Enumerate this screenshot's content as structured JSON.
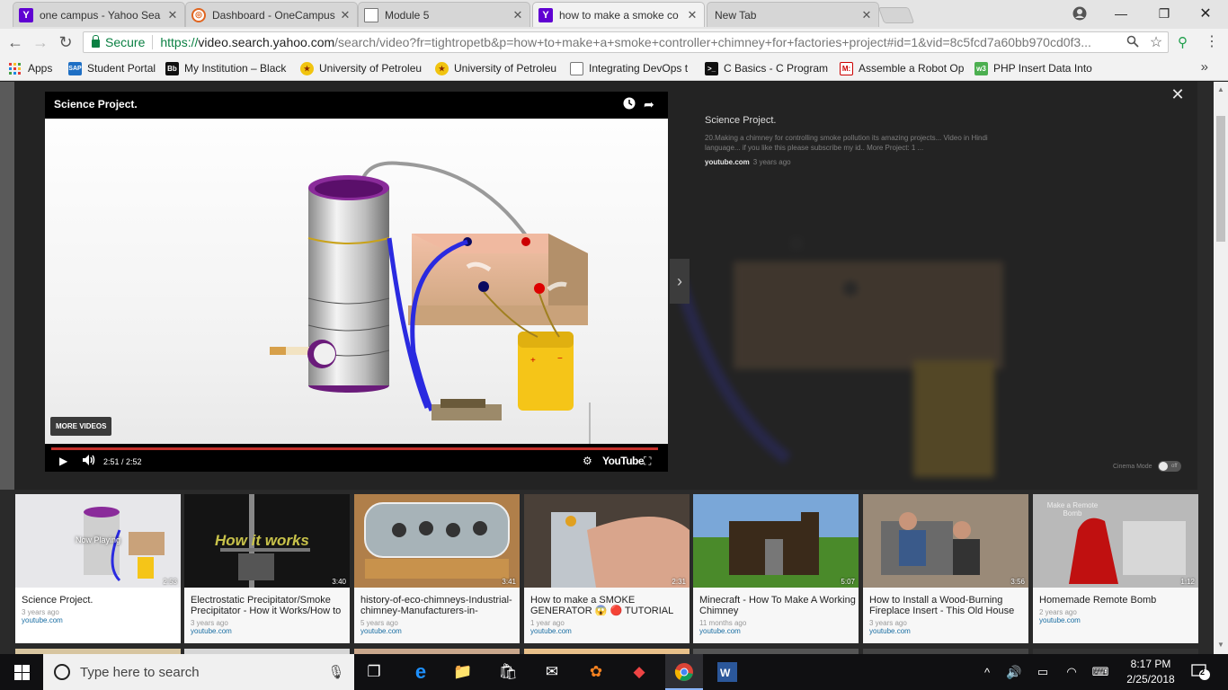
{
  "browser": {
    "tabs": [
      {
        "title": "one campus - Yahoo Sea",
        "favicon": "yahoo-icon",
        "active": false
      },
      {
        "title": "Dashboard - OneCampus",
        "favicon": "globe-icon",
        "active": false
      },
      {
        "title": "Module 5",
        "favicon": "document-icon",
        "active": false
      },
      {
        "title": "how to make a smoke co",
        "favicon": "yahoo-icon",
        "active": true
      },
      {
        "title": "New Tab",
        "favicon": "",
        "active": false
      }
    ],
    "secure_label": "Secure",
    "url_scheme": "https://",
    "url_host": "video.search.yahoo.com",
    "url_path": "/search/video?fr=tightropetb&p=how+to+make+a+smoke+controller+chimney+for+factories+project#id=1&vid=8c5fcd7a60bb970cd0f3...",
    "bookmarks": [
      {
        "label": "Apps",
        "icon": "apps-grid-icon"
      },
      {
        "label": "Student Portal",
        "icon": "sap-icon"
      },
      {
        "label": "My Institution – Black",
        "icon": "blackboard-icon"
      },
      {
        "label": "University of Petroleu",
        "icon": "university-crest-icon"
      },
      {
        "label": "University of Petroleu",
        "icon": "university-crest-icon"
      },
      {
        "label": "Integrating DevOps t",
        "icon": "document-icon"
      },
      {
        "label": "C Basics - C Program",
        "icon": "terminal-icon"
      },
      {
        "label": "Assemble a Robot Op",
        "icon": "mheducation-icon"
      },
      {
        "label": "PHP Insert Data Into",
        "icon": "w3schools-icon"
      }
    ],
    "bookmarks_more": "»"
  },
  "player": {
    "video_title": "Science Project.",
    "more_videos": "MORE VIDEOS",
    "time": "2:51 / 2:52",
    "brand": "YouTube",
    "progress": 0.994
  },
  "info": {
    "title": "Science Project.",
    "description": "20.Making a chimney for controlling smoke pollution its amazing projects... Video in Hindi language... if you like this please subscribe my id.. More Project: 1 ...",
    "source": "youtube.com",
    "age": "3 years ago",
    "cinema_label": "Cinema Mode",
    "cinema_state": "off"
  },
  "results": [
    {
      "title": "Science Project.",
      "age": "3 years ago",
      "source": "youtube.com",
      "duration": "2:53",
      "now_playing": "Now Playing"
    },
    {
      "title": "Electrostatic Precipitator/Smoke Precipitator - How it Works/How to",
      "age": "3 years ago",
      "source": "youtube.com",
      "duration": "3:40",
      "overlay": "How it works"
    },
    {
      "title": "history-of-eco-chimneys-Industrial-chimney-Manufacturers-in-",
      "age": "5 years ago",
      "source": "youtube.com",
      "duration": "3:41"
    },
    {
      "title": "How to make a SMOKE GENERATOR 😱 🔴 TUTORIAL",
      "age": "1 year ago",
      "source": "youtube.com",
      "duration": "2:31"
    },
    {
      "title": "Minecraft - How To Make A Working Chimney",
      "age": "11 months ago",
      "source": "youtube.com",
      "duration": "5:07"
    },
    {
      "title": "How to Install a Wood-Burning Fireplace Insert - This Old House",
      "age": "3 years ago",
      "source": "youtube.com",
      "duration": "3:56"
    },
    {
      "title": "Homemade Remote Bomb",
      "age": "2 years ago",
      "source": "youtube.com",
      "duration": "1:12",
      "overlay": "Make a Remote Bomb"
    }
  ],
  "taskbar": {
    "search_placeholder": "Type here to search",
    "time": "8:17 PM",
    "date": "2/25/2018",
    "notifications": "2"
  }
}
